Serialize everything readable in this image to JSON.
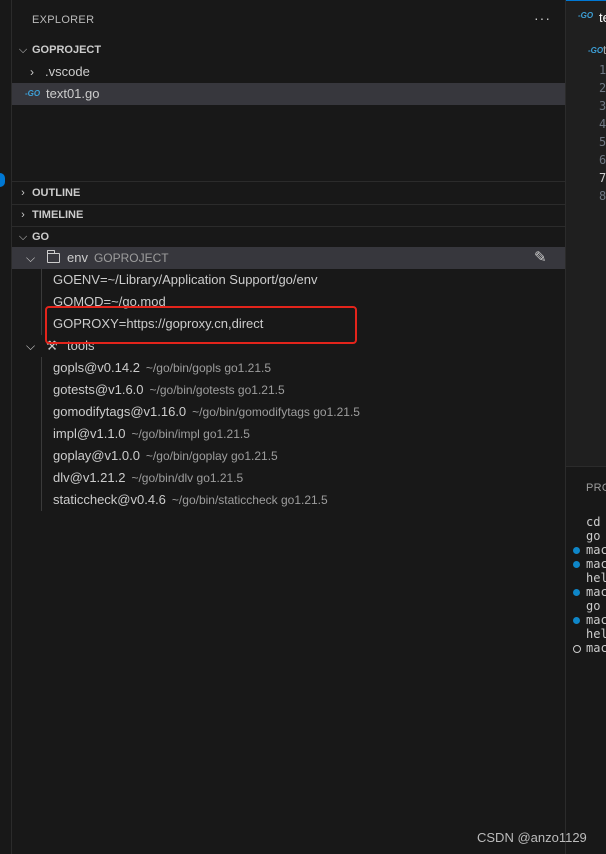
{
  "explorer": {
    "title": "EXPLORER",
    "more": "···"
  },
  "project": {
    "name": "GOPROJECT",
    "items": [
      {
        "label": ".vscode",
        "type": "folder"
      },
      {
        "label": "text01.go",
        "type": "go-file",
        "icon_text": "-GO",
        "selected": true
      }
    ]
  },
  "sections": {
    "outline": "OUTLINE",
    "timeline": "TIMELINE",
    "go": "GO"
  },
  "env": {
    "label": "env",
    "desc": "GOPROJECT",
    "items": [
      "GOENV=~/Library/Application Support/go/env",
      "GOMOD=~/go.mod",
      "GOPROXY=https://goproxy.cn,direct"
    ]
  },
  "tools": {
    "label": "tools",
    "items": [
      {
        "name": "gopls@v0.14.2",
        "desc": "~/go/bin/gopls go1.21.5"
      },
      {
        "name": "gotests@v1.6.0",
        "desc": "~/go/bin/gotests go1.21.5"
      },
      {
        "name": "gomodifytags@v1.16.0",
        "desc": "~/go/bin/gomodifytags go1.21.5"
      },
      {
        "name": "impl@v1.1.0",
        "desc": "~/go/bin/impl go1.21.5"
      },
      {
        "name": "goplay@v1.0.0",
        "desc": "~/go/bin/goplay go1.21.5"
      },
      {
        "name": "dlv@v1.21.2",
        "desc": "~/go/bin/dlv go1.21.5"
      },
      {
        "name": "staticcheck@v0.4.6",
        "desc": "~/go/bin/staticcheck go1.21.5"
      }
    ]
  },
  "editor": {
    "tab_label": "te",
    "tab_icon": "-GO",
    "crumb_label": "t",
    "line_numbers": [
      "1",
      "2",
      "3",
      "4",
      "5",
      "6",
      "7",
      "8"
    ],
    "active_line": "7"
  },
  "panel": {
    "title": "PRO",
    "lines": [
      "cd",
      "go",
      "mac",
      "mac",
      "hel",
      "mac",
      "go",
      "mac",
      "hel",
      "mac"
    ]
  },
  "watermark": "CSDN @anzo1129",
  "colors": {
    "highlight_box": "#e3241b",
    "go_icon": "#3d9fd6",
    "accent": "#0078d4"
  }
}
